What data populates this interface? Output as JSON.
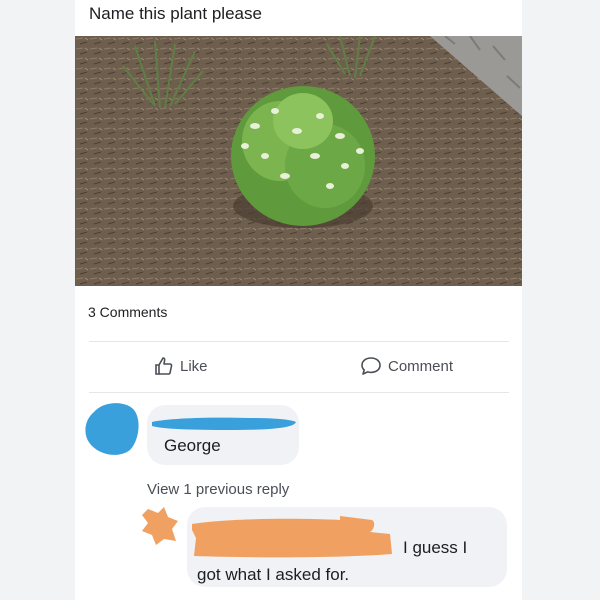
{
  "post": {
    "text": "Name this plant please",
    "comments_count": "3 Comments"
  },
  "actions": {
    "like_label": "Like",
    "comment_label": "Comment"
  },
  "comments": [
    {
      "text": "George"
    }
  ],
  "view_previous": "View 1 previous reply",
  "reply": {
    "text_line1": "I guess I",
    "text_line2": "got what I asked for."
  },
  "colors": {
    "redaction_blue": "#3aa0dc",
    "redaction_orange": "#f0a060",
    "bubble": "#f0f2f5"
  },
  "icons": {
    "like": "thumbs-up-icon",
    "comment": "speech-bubble-icon"
  }
}
